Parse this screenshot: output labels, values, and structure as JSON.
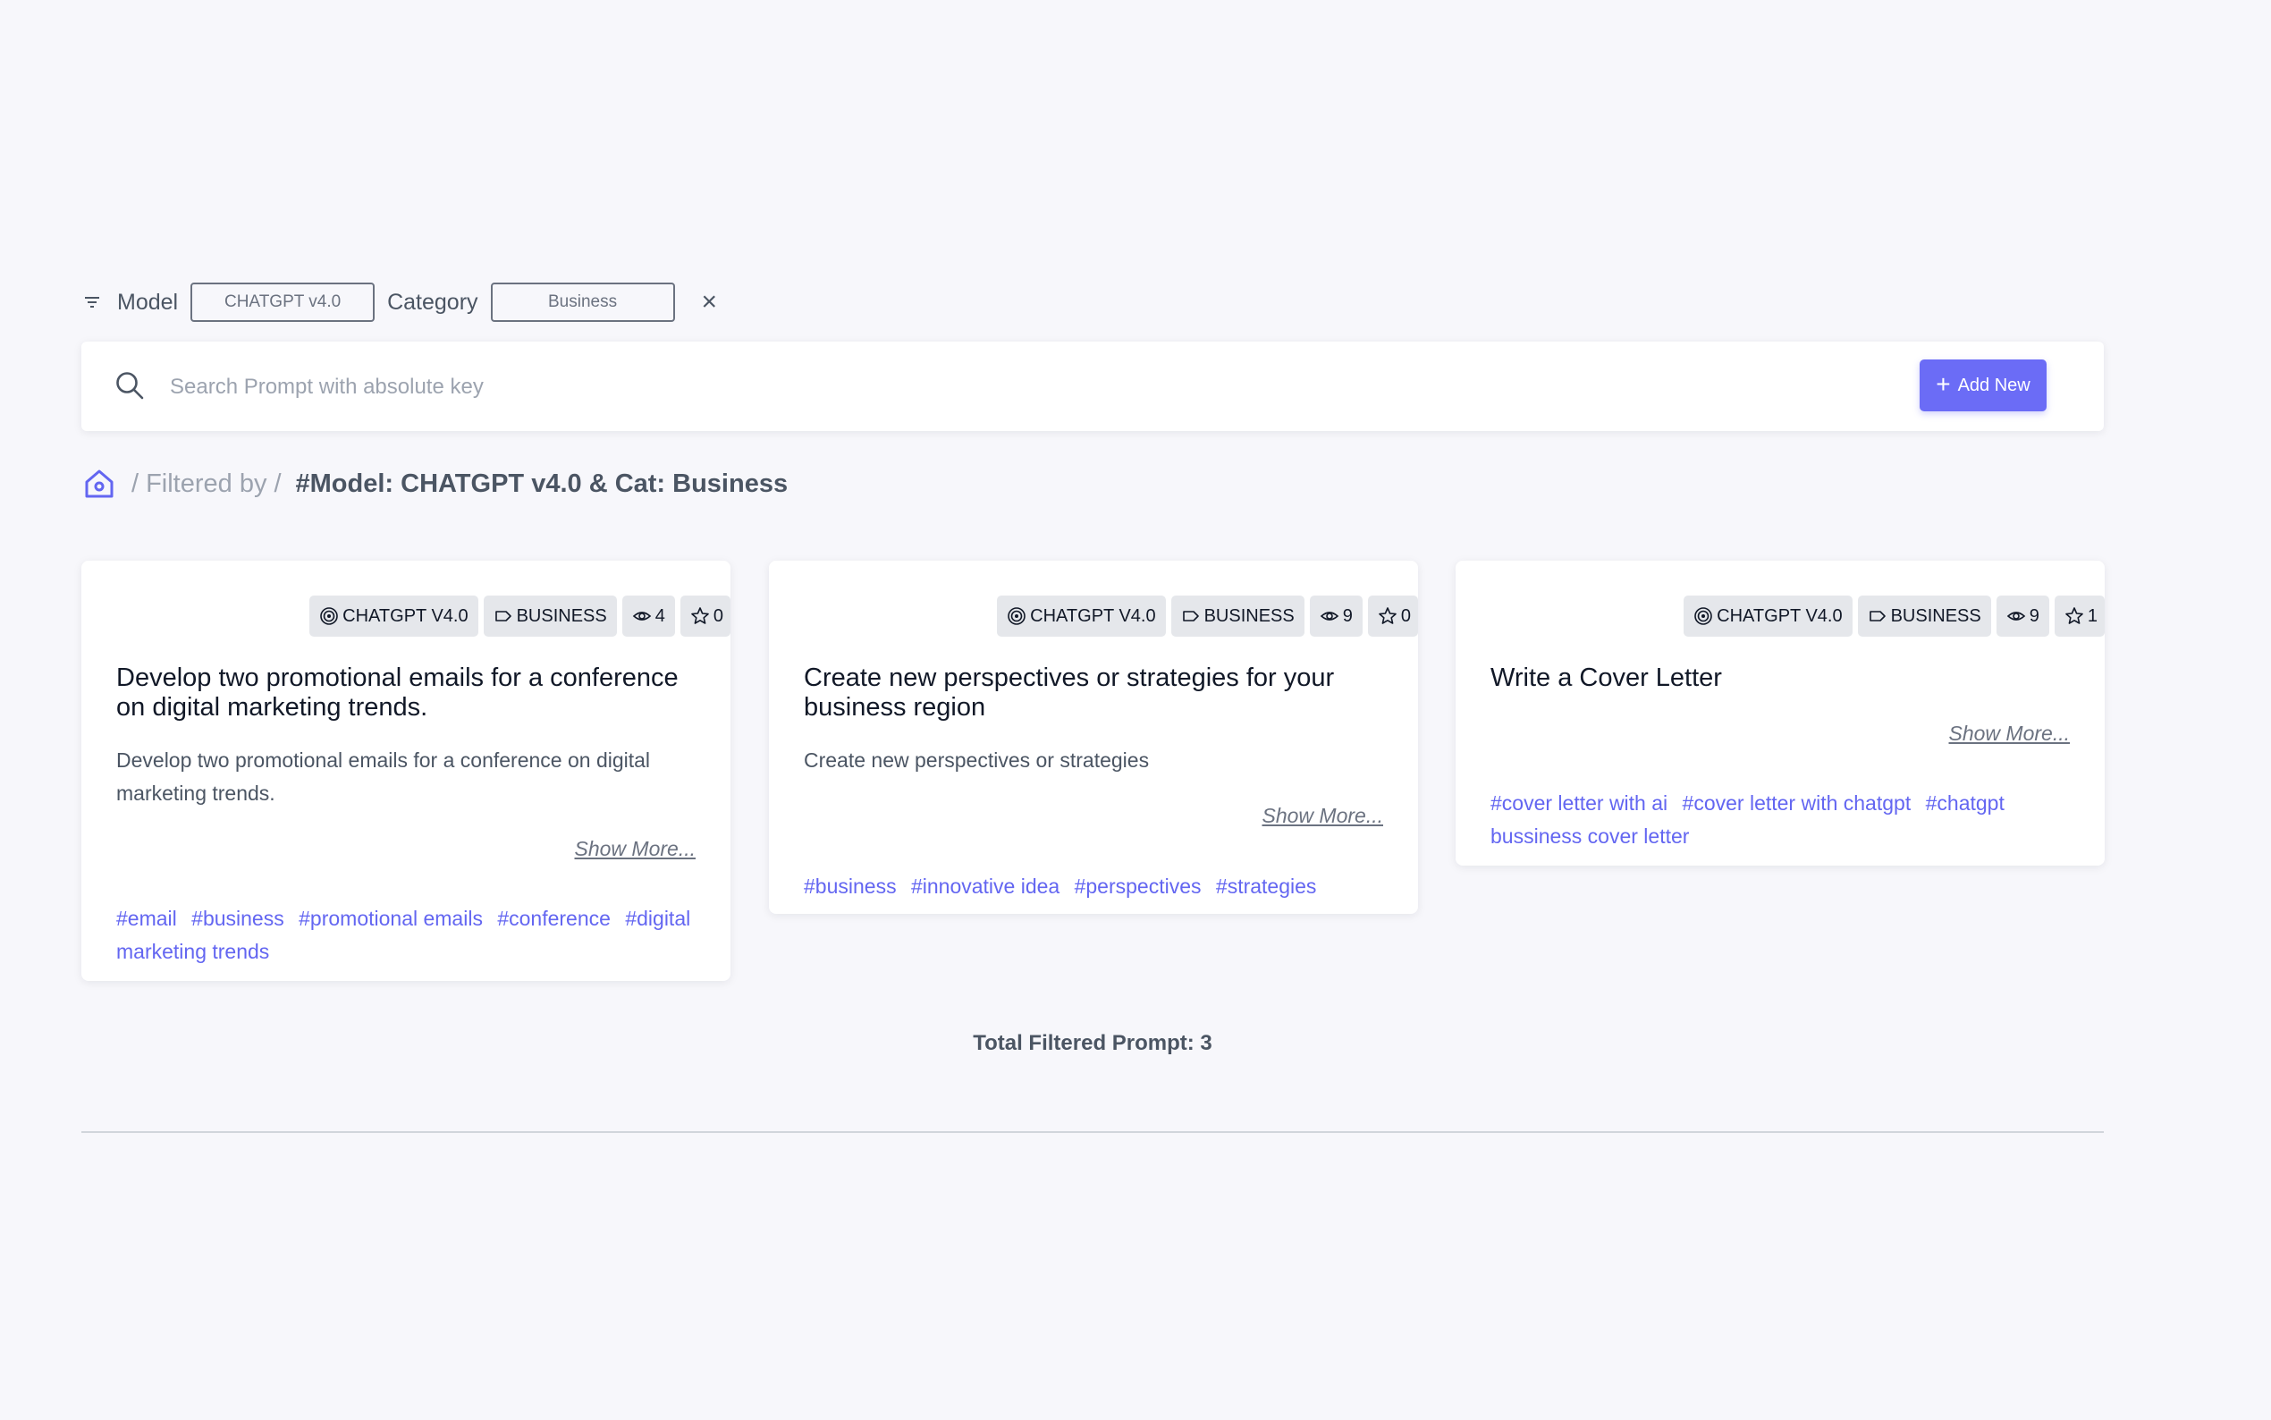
{
  "filters": {
    "model_label": "Model",
    "model_value": "CHATGPT v4.0",
    "category_label": "Category",
    "category_value": "Business",
    "clear_symbol": "×"
  },
  "search": {
    "placeholder": "Search Prompt with absolute key",
    "value": ""
  },
  "add_button": {
    "label": "Add New"
  },
  "breadcrumb": {
    "separator": "/",
    "filtered_by": "Filtered by",
    "current": "#Model: CHATGPT v4.0 & Cat: Business"
  },
  "cards": [
    {
      "model": "CHATGPT V4.0",
      "category": "BUSINESS",
      "views": "4",
      "stars": "0",
      "title": "Develop two promotional emails for a conference on digital marketing trends.",
      "description": "Develop two promotional emails for a conference on digital marketing trends.",
      "show_more": "Show More...",
      "tags": [
        "#email",
        "#business",
        "#promotional emails",
        "#conference",
        "#digital marketing trends"
      ]
    },
    {
      "model": "CHATGPT V4.0",
      "category": "BUSINESS",
      "views": "9",
      "stars": "0",
      "title": "Create new perspectives or strategies for your business region",
      "description": "Create new perspectives or strategies",
      "show_more": "Show More...",
      "tags": [
        "#business",
        "#innovative idea",
        "#perspectives",
        "#strategies"
      ]
    },
    {
      "model": "CHATGPT V4.0",
      "category": "BUSINESS",
      "views": "9",
      "stars": "1",
      "title": "Write a Cover Letter",
      "description": "",
      "show_more": "Show More...",
      "tags": [
        "#cover letter with ai",
        "#cover letter with chatgpt",
        "#chatgpt bussiness cover letter"
      ]
    }
  ],
  "total": {
    "label": "Total Filtered Prompt: 3"
  },
  "colors": {
    "accent": "#6b6cf6",
    "tag": "#6366f1",
    "background": "#f7f7fb"
  },
  "icons": [
    "filter-icon",
    "search-icon",
    "plus-icon",
    "home-icon",
    "target-icon",
    "tag-icon",
    "eye-icon",
    "star-icon",
    "close-icon"
  ]
}
